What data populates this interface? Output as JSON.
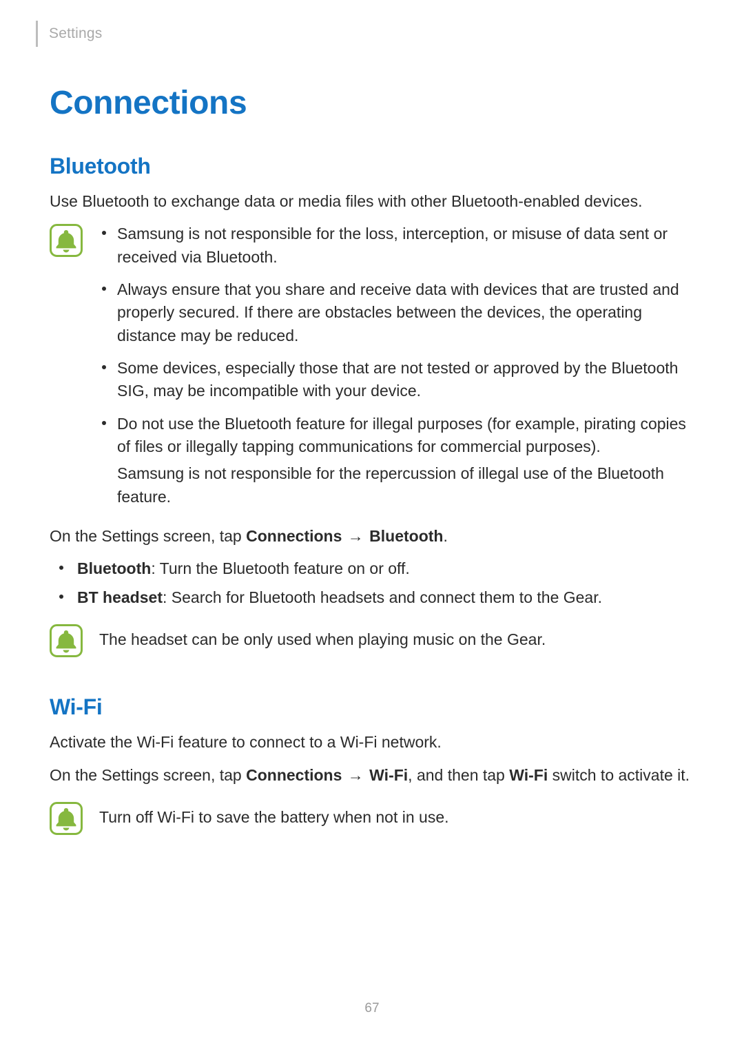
{
  "header": {
    "breadcrumb": "Settings"
  },
  "h1": "Connections",
  "bluetooth": {
    "heading": "Bluetooth",
    "intro": "Use Bluetooth to exchange data or media files with other Bluetooth-enabled devices.",
    "notes": [
      "Samsung is not responsible for the loss, interception, or misuse of data sent or received via Bluetooth.",
      "Always ensure that you share and receive data with devices that are trusted and properly secured. If there are obstacles between the devices, the operating distance may be reduced.",
      "Some devices, especially those that are not tested or approved by the Bluetooth SIG, may be incompatible with your device.",
      "Do not use the Bluetooth feature for illegal purposes (for example, pirating copies of files or illegally tapping communications for commercial purposes).",
      "Samsung is not responsible for the repercussion of illegal use of the Bluetooth feature."
    ],
    "path_prefix": "On the Settings screen, tap ",
    "path_bold1": "Connections",
    "arrow": " → ",
    "path_bold2": "Bluetooth",
    "path_suffix": ".",
    "options": [
      {
        "term": "Bluetooth",
        "desc": ": Turn the Bluetooth feature on or off."
      },
      {
        "term": "BT headset",
        "desc": ": Search for Bluetooth headsets and connect them to the Gear."
      }
    ],
    "headset_note": "The headset can be only used when playing music on the Gear."
  },
  "wifi": {
    "heading": "Wi-Fi",
    "intro": "Activate the Wi-Fi feature to connect to a Wi-Fi network.",
    "path_prefix": "On the Settings screen, tap ",
    "path_bold1": "Connections",
    "arrow": " → ",
    "path_bold2": "Wi-Fi",
    "mid": ", and then tap ",
    "path_bold3": "Wi-Fi",
    "path_suffix": " switch to activate it.",
    "note": "Turn off Wi-Fi to save the battery when not in use."
  },
  "page_number": "67",
  "colors": {
    "accent": "#1474c4",
    "icon_green": "#86b83f"
  }
}
